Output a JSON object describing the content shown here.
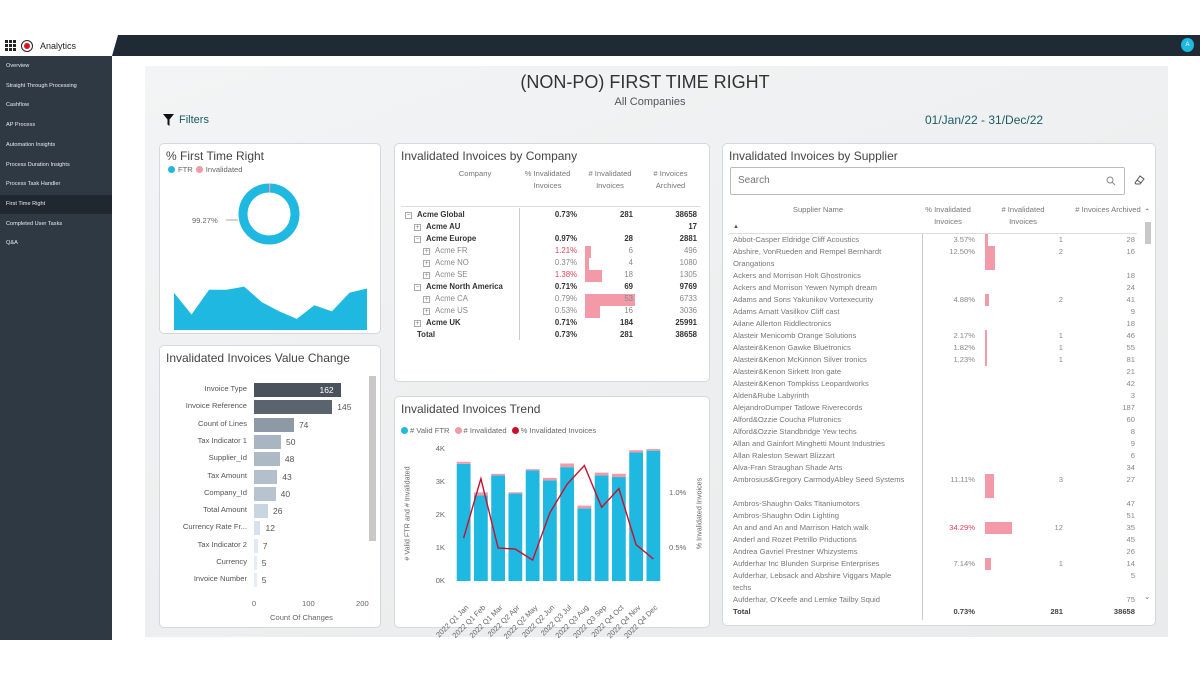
{
  "app": {
    "name": "Analytics",
    "user_initial": "A"
  },
  "sidebar": {
    "items": [
      {
        "label": "Overview"
      },
      {
        "label": "Straight Through Processing"
      },
      {
        "label": "Cashflow"
      },
      {
        "label": "AP Process"
      },
      {
        "label": "Automation Insights"
      },
      {
        "label": "Process Duration Insights"
      },
      {
        "label": "Process Task Handler"
      },
      {
        "label": "First Time Right",
        "active": true
      },
      {
        "label": "Completed User Tasks"
      },
      {
        "label": "Q&A"
      }
    ]
  },
  "header": {
    "title": "(NON-PO)  FIRST TIME RIGHT",
    "subtitle": "All Companies",
    "filters_label": "Filters",
    "date_range": "01/Jan/22 - 31/Dec/22"
  },
  "colors": {
    "accent": "#1fb8e0",
    "invalidated": "#f29aa8",
    "line": "#c8102e",
    "nav": "#2e3944",
    "teal_text": "#1c5b63"
  },
  "ftr_card": {
    "title": "% First Time Right",
    "legend": [
      "FTR",
      "Invalidated"
    ],
    "ftr_pct": 99.27,
    "invalidated_pct": 0.73,
    "donut_label": "99.27%",
    "area_values": [
      60,
      25,
      65,
      65,
      70,
      45,
      30,
      18,
      40,
      30,
      60,
      67
    ]
  },
  "company_table": {
    "title": "Invalidated Invoices by Company",
    "headers": [
      "Company",
      "% Invalidated Invoices",
      "# Invalidated Invoices",
      "# Invoices Archived"
    ],
    "rows": [
      {
        "name": "Acme Global",
        "level": 0,
        "expand": "minus",
        "bold": true,
        "pct": "0.73%",
        "inv": "281",
        "arch": "38658"
      },
      {
        "name": "Acme AU",
        "level": 1,
        "expand": "plus",
        "bold": true,
        "pct": "",
        "inv": "",
        "arch": "17"
      },
      {
        "name": "Acme Europe",
        "level": 1,
        "expand": "minus",
        "bold": true,
        "pct": "0.97%",
        "inv": "28",
        "arch": "2881"
      },
      {
        "name": "Acme FR",
        "level": 2,
        "expand": "plus",
        "pct": "1.21%",
        "red": true,
        "inv": "6",
        "arch": "496"
      },
      {
        "name": "Acme NO",
        "level": 2,
        "expand": "plus",
        "pct": "0.37%",
        "inv": "4",
        "arch": "1080"
      },
      {
        "name": "Acme SE",
        "level": 2,
        "expand": "plus",
        "pct": "1.38%",
        "red": true,
        "inv": "18",
        "arch": "1305"
      },
      {
        "name": "Acme North America",
        "level": 1,
        "expand": "minus",
        "bold": true,
        "pct": "0.71%",
        "inv": "69",
        "arch": "9769"
      },
      {
        "name": "Acme CA",
        "level": 2,
        "expand": "plus",
        "pct": "0.79%",
        "inv": "53",
        "arch": "6733"
      },
      {
        "name": "Acme US",
        "level": 2,
        "expand": "plus",
        "pct": "0.53%",
        "inv": "16",
        "arch": "3036"
      },
      {
        "name": "Acme UK",
        "level": 1,
        "expand": "plus",
        "bold": true,
        "pct": "0.71%",
        "inv": "184",
        "arch": "25991"
      },
      {
        "name": "Total",
        "level": 0,
        "bold": true,
        "pct": "0.73%",
        "inv": "281",
        "arch": "38658"
      }
    ]
  },
  "supplier_table": {
    "title": "Invalidated Invoices by Supplier",
    "search_placeholder": "Search",
    "headers": [
      "Supplier Name",
      "% Invalidated Invoices",
      "# Invalidated Invoices",
      "# Invoices Archived"
    ],
    "rows": [
      {
        "name": "Abbot-Casper Eldridge Cliff Acoustics",
        "pct": "3.57%",
        "pv": 3.57,
        "inv": "1",
        "arch": "28"
      },
      {
        "name": "Abshire, VonRueden and Rempel Bernhardt Orangations",
        "wrap": true,
        "pct": "12.50%",
        "pv": 12.5,
        "inv": "2",
        "arch": "16"
      },
      {
        "name": "Ackers and Morrison Holt Ghostronics",
        "pct": "",
        "inv": "",
        "arch": "18"
      },
      {
        "name": "Ackers and Morrison Yewen Nymph dream",
        "pct": "",
        "inv": "",
        "arch": "24"
      },
      {
        "name": "Adams and Sons Yakunikov Vortexecurity",
        "pct": "4.88%",
        "pv": 4.88,
        "inv": "2",
        "arch": "41"
      },
      {
        "name": "Adams Arnatt Vasilkov Cliff cast",
        "pct": "",
        "inv": "",
        "arch": "9"
      },
      {
        "name": "Ailane Allerton Riddlectronics",
        "pct": "",
        "inv": "",
        "arch": "18"
      },
      {
        "name": "Alasteir Menicomb Orange Solutions",
        "pct": "2.17%",
        "pv": 2.17,
        "inv": "1",
        "arch": "46"
      },
      {
        "name": "Alasteir&Kenon Gawke Bluetronics",
        "pct": "1.82%",
        "pv": 1.82,
        "inv": "1",
        "arch": "55"
      },
      {
        "name": "Alasteir&Kenon McKinnon Silver tronics",
        "pct": "1.23%",
        "pv": 1.23,
        "inv": "1",
        "arch": "81"
      },
      {
        "name": "Alasteir&Kenon Sirkett Iron gate",
        "pct": "",
        "inv": "",
        "arch": "21"
      },
      {
        "name": "Alasteir&Kenon Tompkiss Leopardworks",
        "pct": "",
        "inv": "",
        "arch": "42"
      },
      {
        "name": "Alden&Rube Labyrinth",
        "pct": "",
        "inv": "",
        "arch": "3"
      },
      {
        "name": "AlejandroDumper Tatlowe Riverecords",
        "pct": "",
        "inv": "",
        "arch": "187"
      },
      {
        "name": "Alford&Ozzie Coucha Plutronics",
        "pct": "",
        "inv": "",
        "arch": "60"
      },
      {
        "name": "Alford&Ozzie Standbridge Yew techs",
        "pct": "",
        "inv": "",
        "arch": "8"
      },
      {
        "name": "Allan and Gainfort Minghetti Mount Industries",
        "pct": "",
        "inv": "",
        "arch": "9"
      },
      {
        "name": "Allan Raleston Sewart Blizzart",
        "pct": "",
        "inv": "",
        "arch": "6"
      },
      {
        "name": "Alva-Fran Straughan Shade Arts",
        "pct": "",
        "inv": "",
        "arch": "34"
      },
      {
        "name": "Ambrosius&Gregory CarmodyAbley Seed Systems",
        "wrap": true,
        "pct": "11.11%",
        "pv": 11.11,
        "inv": "3",
        "arch": "27"
      },
      {
        "name": "Ambros-Shaughn Oaks Titaniumotors",
        "pct": "",
        "inv": "",
        "arch": "47"
      },
      {
        "name": "Ambros-Shaughn Odin Lighting",
        "pct": "",
        "inv": "",
        "arch": "51"
      },
      {
        "name": "An and and An and Marrison Hatch walk",
        "pct": "34.29%",
        "pv": 34.29,
        "red": true,
        "inv": "12",
        "arch": "35"
      },
      {
        "name": "Anderl and Rozet Petrillo Priductions",
        "pct": "",
        "inv": "",
        "arch": "45"
      },
      {
        "name": "Andrea Gavriel Prestner Whizystems",
        "pct": "",
        "inv": "",
        "arch": "26"
      },
      {
        "name": "Aufderhar Inc Blunden Surprise Enterprises",
        "pct": "7.14%",
        "pv": 7.14,
        "inv": "1",
        "arch": "14"
      },
      {
        "name": "Aufderhar, Lebsack and Abshire Viggars Maple techs",
        "wrap": true,
        "pct": "",
        "inv": "",
        "arch": "5"
      },
      {
        "name": "Aufderhar, O'Keefe and Lemke Tailby Squid",
        "pct": "",
        "inv": "",
        "arch": "75"
      }
    ],
    "total": {
      "name": "Total",
      "pct": "0.73%",
      "inv": "281",
      "arch": "38658"
    }
  },
  "chart_data": [
    {
      "type": "bar",
      "orientation": "horizontal",
      "title": "Invalidated Invoices Value Change",
      "xlabel": "Count Of Changes",
      "xlim": [
        0,
        200
      ],
      "xticks": [
        "0",
        "100",
        "200"
      ],
      "categories": [
        "Invoice Type",
        "Invoice Reference",
        "Count of Lines",
        "Tax Indicator 1",
        "Supplier_Id",
        "Tax Amount",
        "Company_Id",
        "Total Amount",
        "Currency Rate Fr...",
        "Tax Indicator 2",
        "Currency",
        "Invoice Number"
      ],
      "values": [
        162,
        145,
        74,
        50,
        48,
        43,
        40,
        26,
        12,
        7,
        5,
        5
      ],
      "bar_colors": [
        "#4a525d",
        "#5b636e",
        "#8e99a6",
        "#a9b5c1",
        "#adb9c5",
        "#b3bfcb",
        "#b7c3cf",
        "#c9d5e0",
        "#d6e2ee",
        "#dfeaf5",
        "#e2edf7",
        "#e2edf7"
      ]
    },
    {
      "type": "bar+line",
      "title": "Invalidated Invoices Trend",
      "categories": [
        "2022 Q1 Jan",
        "2022 Q1 Feb",
        "2022 Q1 Mar",
        "2022 Q2 Apr",
        "2022 Q2 May",
        "2022 Q2 Jun",
        "2022 Q3 Jul",
        "2022 Q3 Aug",
        "2022 Q3 Sep",
        "2022 Q4 Oct",
        "2022 Q4 Nov",
        "2022 Q4 Dec"
      ],
      "ylabel": "# Valid FTR and # Invalidated",
      "y2label": "% Invalidated Invoices",
      "ylim": [
        0,
        4000
      ],
      "yticks": [
        "0K",
        "1K",
        "2K",
        "3K",
        "4K"
      ],
      "y2lim": [
        0.2,
        1.4
      ],
      "y2ticks": [
        {
          "v": 0.5,
          "label": "0.5%"
        },
        {
          "v": 1.0,
          "label": "1.0%"
        }
      ],
      "legend_position": "top-left",
      "series": [
        {
          "name": "# Valid FTR",
          "type": "bar",
          "color": "#1fb8e0",
          "values": [
            3550,
            2600,
            3200,
            2650,
            3350,
            3050,
            3450,
            2200,
            3200,
            3150,
            3900,
            3950
          ]
        },
        {
          "name": "# Invalidated",
          "type": "bar-stacked",
          "color": "#f29aa8",
          "values": [
            21,
            29,
            16,
            13,
            13,
            25,
            37,
            28,
            28,
            33,
            21,
            16
          ]
        },
        {
          "name": "% Invalidated Invoices",
          "type": "line",
          "color": "#c8102e",
          "values": [
            0.59,
            1.13,
            0.5,
            0.49,
            0.39,
            0.82,
            1.08,
            1.25,
            0.87,
            1.04,
            0.53,
            0.4
          ]
        }
      ]
    }
  ]
}
